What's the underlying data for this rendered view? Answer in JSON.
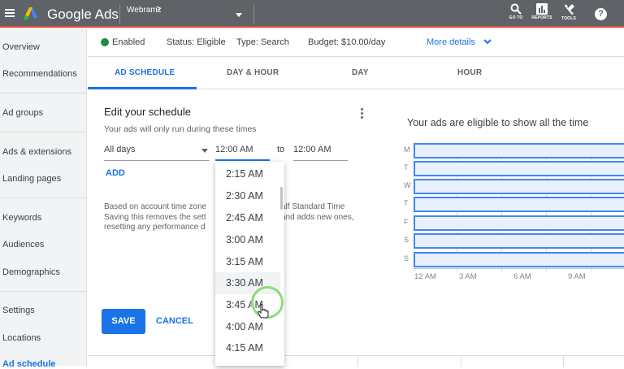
{
  "header": {
    "app_title": "Google Ads",
    "account_name": "Webramz",
    "account_chevron": ">",
    "tools": [
      {
        "label": "GO TO",
        "icon": "search-icon"
      },
      {
        "label": "REPORTS",
        "icon": "reports-icon"
      },
      {
        "label": "TOOLS",
        "icon": "wrench-icon"
      }
    ],
    "help_label": "?"
  },
  "sidebar": {
    "items": [
      {
        "label": "Overview"
      },
      {
        "label": "Recommendations"
      },
      {
        "label": "Ad groups"
      },
      {
        "label": "Ads & extensions"
      },
      {
        "label": "Landing pages"
      },
      {
        "label": "Keywords"
      },
      {
        "label": "Audiences"
      },
      {
        "label": "Demographics"
      },
      {
        "label": "Settings"
      },
      {
        "label": "Locations"
      },
      {
        "label": "Ad schedule"
      }
    ]
  },
  "status_bar": {
    "enabled_label": "Enabled",
    "status_text": "Status: Eligible",
    "type_text": "Type: Search",
    "budget_text": "Budget: $10.00/day",
    "more_details": "More details"
  },
  "tabs": [
    {
      "label": "AD SCHEDULE",
      "active": true
    },
    {
      "label": "DAY & HOUR",
      "active": false
    },
    {
      "label": "DAY",
      "active": false
    },
    {
      "label": "HOUR",
      "active": false
    }
  ],
  "editor": {
    "title": "Edit your schedule",
    "subtitle": "Your ads will only run during these times",
    "days_value": "All days",
    "from_value": "12:00 AM",
    "to_label": "to",
    "to_value": "12:00 AM",
    "add_label": "ADD",
    "info_lines": [
      "Based on account time zone",
      "Saving this removes the sett",
      "resetting any performance d"
    ],
    "info_lines_right": [
      "alf Standard Time",
      "and adds new ones,"
    ],
    "save_label": "SAVE",
    "cancel_label": "CANCEL"
  },
  "time_dropdown": {
    "options": [
      "2:15 AM",
      "2:30 AM",
      "2:45 AM",
      "3:00 AM",
      "3:15 AM",
      "3:30 AM",
      "3:45 AM",
      "4:00 AM",
      "4:15 AM"
    ],
    "hovered": "3:30 AM"
  },
  "schedule_chart": {
    "title": "Your ads are eligible to show all the time",
    "days": [
      "M",
      "T",
      "W",
      "T",
      "F",
      "S",
      "S"
    ],
    "hour_labels": [
      "12 AM",
      "3 AM",
      "6 AM",
      "9 AM"
    ],
    "bar_color": "#e8f0fe",
    "bar_border": "#4285f4"
  },
  "colors": {
    "accent": "#1a73e8",
    "topbar": "#5f6368",
    "enabled_dot": "#1e8e3e"
  }
}
